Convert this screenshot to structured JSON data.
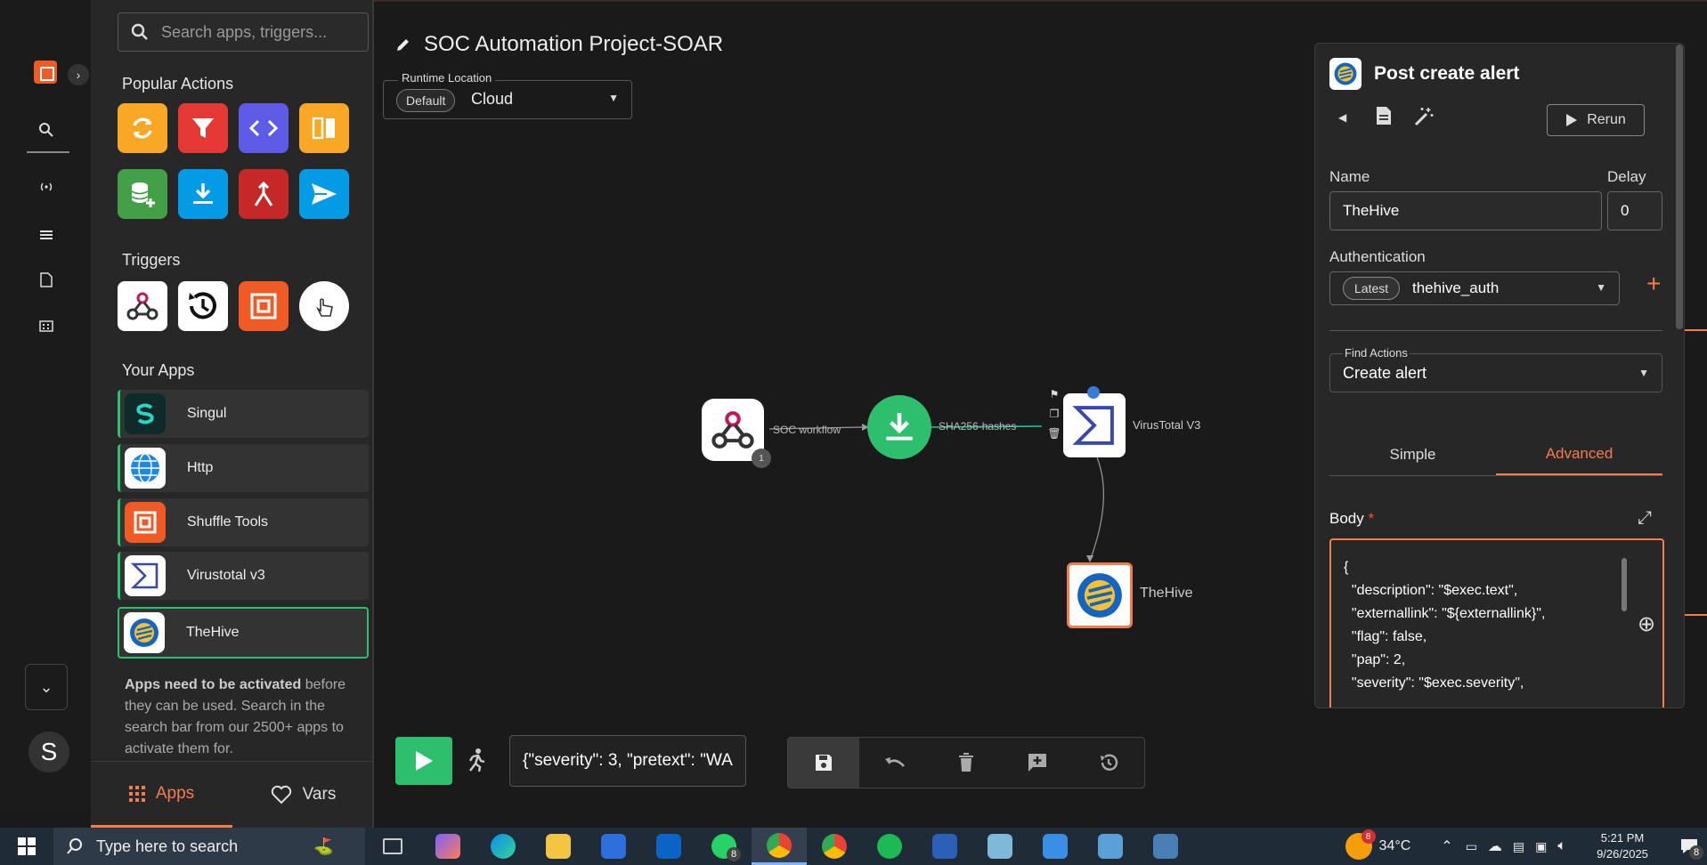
{
  "sidebar": {
    "search_placeholder": "Search apps, triggers...",
    "popular_actions_title": "Popular Actions",
    "triggers_title": "Triggers",
    "your_apps_title": "Your Apps",
    "apps": [
      {
        "label": "Singul"
      },
      {
        "label": "Http"
      },
      {
        "label": "Shuffle Tools"
      },
      {
        "label": "Virustotal v3"
      },
      {
        "label": "TheHive"
      }
    ],
    "note_bold": "Apps need to be activated",
    "note_rest": " before they can be used. Search in the search bar from our 2500+ apps to activate them for.",
    "tabs": {
      "apps": "Apps",
      "vars": "Vars"
    }
  },
  "rail": {
    "avatar_letter": "S"
  },
  "workflow": {
    "title": "SOC Automation Project-SOAR",
    "runtime_label": "Runtime Location",
    "runtime_default": "Default",
    "runtime_value": "Cloud",
    "edges": [
      "SOC workflow",
      "SHA256-hashes"
    ],
    "nodes": {
      "virustotal": "VirusTotal V3",
      "thehive": "TheHive"
    },
    "start_badge": "1",
    "exec_argument": "{\"severity\": 3, \"pretext\": \"WA"
  },
  "panel": {
    "title": "Post create alert",
    "rerun_label": "Rerun",
    "name_label": "Name",
    "name_value": "TheHive",
    "delay_label": "Delay",
    "delay_value": "0",
    "auth_label": "Authentication",
    "auth_latest": "Latest",
    "auth_value": "thehive_auth",
    "find_actions_label": "Find Actions",
    "find_actions_value": "Create alert",
    "tabs": {
      "simple": "Simple",
      "advanced": "Advanced"
    },
    "body_label": "Body",
    "body_required": "*",
    "body_lines": [
      "{",
      "  \"description\": \"$exec.text\",",
      "  \"externallink\": \"${externallink}\",",
      "  \"flag\": false,",
      "  \"pap\": 2,",
      "  \"severity\": \"$exec.severity\","
    ]
  },
  "taskbar": {
    "search_placeholder": "Type here to search",
    "weather_badge": "8",
    "temperature": "34°C",
    "whatsapp_badge": "8",
    "notifications_badge": "8",
    "time": "5:21 PM",
    "date": "9/26/2025"
  },
  "colors": {
    "accent": "#f37b50",
    "success": "#2dbf6e",
    "brand": "#f05a24"
  }
}
